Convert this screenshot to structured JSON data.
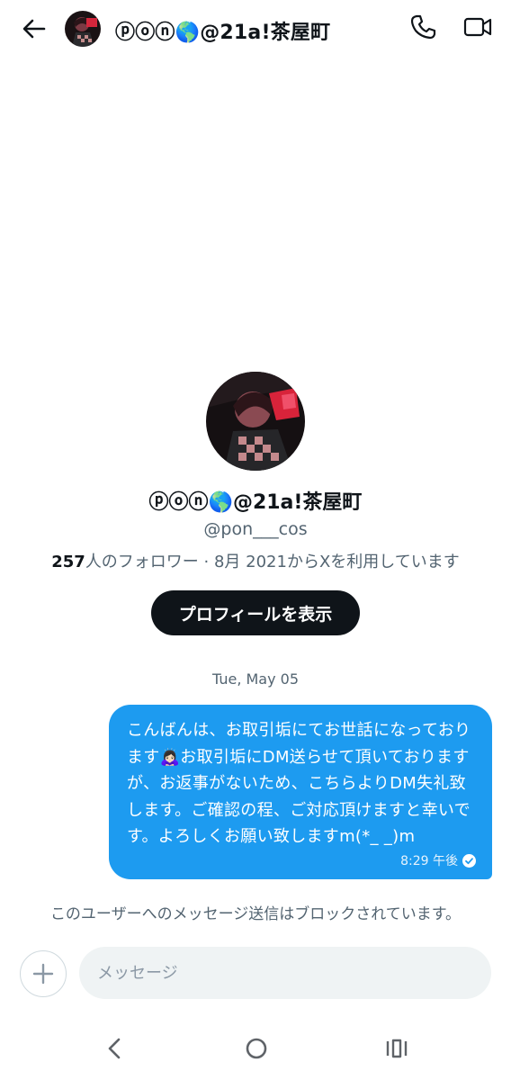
{
  "header": {
    "display_name": "ⓟⓞⓝ🌎@21a!茶屋町",
    "back_icon": "arrow-left-icon",
    "call_icon": "phone-icon",
    "video_icon": "video-icon"
  },
  "profile": {
    "display_name": "ⓟⓞⓝ🌎@21a!茶屋町",
    "handle": "@pon___cos",
    "followers_count": "257",
    "meta_rest": "人のフォロワー · 8月 2021からXを利用しています",
    "view_profile_label": "プロフィールを表示"
  },
  "conversation": {
    "date_label": "Tue, May 05",
    "messages": [
      {
        "text": "こんばんは、お取引垢にてお世話になっております🙇🏻‍♀️お取引垢にDM送らせて頂いておりますが、お返事がないため、こちらよりDM失礼致します。ご確認の程、ご対応頂けますと幸いです。よろしくお願い致しますm(*_ _)m",
        "time": "8:29 午後",
        "status_icon": "read-check-icon"
      }
    ],
    "blocked_notice": "このユーザーへのメッセージ送信はブロックされています。"
  },
  "composer": {
    "placeholder": "メッセージ",
    "add_icon": "plus-icon"
  },
  "system_nav": {
    "back_icon": "nav-back-icon",
    "home_icon": "nav-home-icon",
    "recents_icon": "nav-recents-icon"
  },
  "colors": {
    "accent": "#1d9bf0",
    "primary_text": "#0f1419",
    "secondary_text": "#536471",
    "button_dark": "#0f1419",
    "composer_bg": "#eff3f4"
  }
}
